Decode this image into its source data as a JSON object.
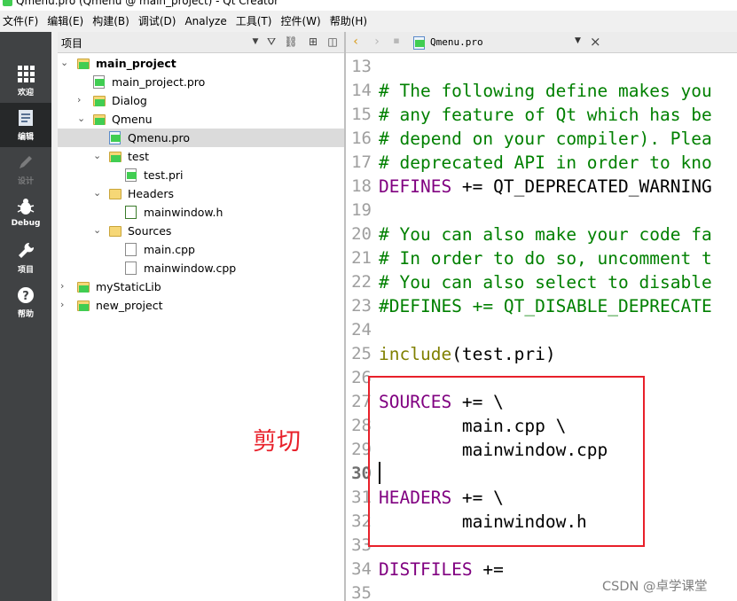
{
  "window": {
    "title": "Qmenu.pro (Qmenu @ main_project) - Qt Creator"
  },
  "menubar": [
    "文件(F)",
    "编辑(E)",
    "构建(B)",
    "调试(D)",
    "Analyze",
    "工具(T)",
    "控件(W)",
    "帮助(H)"
  ],
  "modes": [
    {
      "label": "欢迎",
      "icon": "grid-icon"
    },
    {
      "label": "编辑",
      "icon": "document-icon"
    },
    {
      "label": "设计",
      "icon": "pencil-icon"
    },
    {
      "label": "Debug",
      "icon": "bug-icon"
    },
    {
      "label": "项目",
      "icon": "wrench-icon"
    },
    {
      "label": "帮助",
      "icon": "help-icon"
    }
  ],
  "project_pane": {
    "title": "项目",
    "tree": [
      {
        "label": "main_project"
      },
      {
        "label": "main_project.pro"
      },
      {
        "label": "Dialog"
      },
      {
        "label": "Qmenu"
      },
      {
        "label": "Qmenu.pro"
      },
      {
        "label": "test"
      },
      {
        "label": "test.pri"
      },
      {
        "label": "Headers"
      },
      {
        "label": "mainwindow.h"
      },
      {
        "label": "Sources"
      },
      {
        "label": "main.cpp"
      },
      {
        "label": "mainwindow.cpp"
      },
      {
        "label": "myStaticLib"
      },
      {
        "label": "new_project"
      }
    ]
  },
  "editor": {
    "file_name": "Qmenu.pro",
    "current_line": "30",
    "lines": [
      {
        "num": "13",
        "text": ""
      },
      {
        "num": "14",
        "text": "# The following define makes you"
      },
      {
        "num": "15",
        "text": "# any feature of Qt which has be"
      },
      {
        "num": "16",
        "text": "# depend on your compiler). Plea"
      },
      {
        "num": "17",
        "text": "# deprecated API in order to kno"
      },
      {
        "num": "18",
        "kw": "DEFINES",
        "text": " += QT_DEPRECATED_WARNING"
      },
      {
        "num": "19",
        "text": ""
      },
      {
        "num": "20",
        "text": "# You can also make your code fa"
      },
      {
        "num": "21",
        "text": "# In order to do so, uncomment t"
      },
      {
        "num": "22",
        "text": "# You can also select to disable"
      },
      {
        "num": "23",
        "text": "#DEFINES += QT_DISABLE_DEPRECATE"
      },
      {
        "num": "24",
        "text": ""
      },
      {
        "num": "25",
        "fn": "include",
        "text": "(test.pri)"
      },
      {
        "num": "26",
        "text": ""
      },
      {
        "num": "27",
        "kw": "SOURCES",
        "text": " += \\"
      },
      {
        "num": "28",
        "text": "        main.cpp \\"
      },
      {
        "num": "29",
        "text": "        mainwindow.cpp"
      },
      {
        "num": "30",
        "text": ""
      },
      {
        "num": "31",
        "kw": "HEADERS",
        "text": " += \\"
      },
      {
        "num": "32",
        "text": "        mainwindow.h"
      },
      {
        "num": "33",
        "text": ""
      },
      {
        "num": "34",
        "kw": "DISTFILES",
        "text": " +="
      },
      {
        "num": "35",
        "text": ""
      }
    ]
  },
  "annotation": {
    "label": "剪切",
    "color": "#e8202a"
  },
  "watermark": "CSDN @卓学课堂",
  "colors": {
    "comment": "#008000",
    "keyword": "#800080",
    "function": "#808000",
    "sidebar": "#404244"
  }
}
